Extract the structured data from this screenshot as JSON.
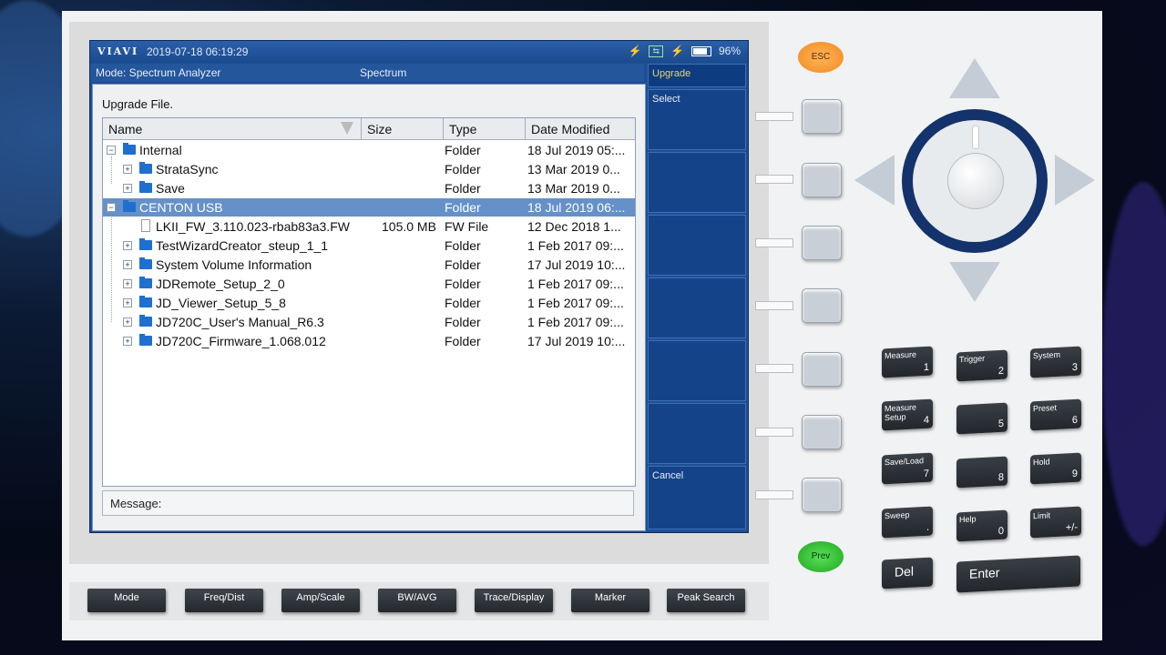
{
  "status": {
    "brand": "VIAVI",
    "datetime": "2019-07-18  06:19:29",
    "battery": "96%"
  },
  "mode": {
    "label": "Mode: Spectrum Analyzer",
    "view": "Spectrum"
  },
  "softkeys": [
    "Upgrade",
    "Select",
    "",
    "",
    "",
    "",
    "",
    "Cancel"
  ],
  "panel": {
    "title": "Upgrade File.",
    "columns": [
      "Name",
      "Size",
      "Type",
      "Date Modified"
    ],
    "rows": [
      {
        "name": "Internal",
        "size": "",
        "type": "Folder",
        "date": "18 Jul 2019 05:..."
      },
      {
        "name": "StrataSync",
        "size": "",
        "type": "Folder",
        "date": "13 Mar 2019 0..."
      },
      {
        "name": "Save",
        "size": "",
        "type": "Folder",
        "date": "13 Mar 2019 0..."
      },
      {
        "name": "CENTON USB",
        "size": "",
        "type": "Folder",
        "date": "18 Jul 2019 06:..."
      },
      {
        "name": "LKII_FW_3.110.023-rbab83a3.FW",
        "size": "105.0 MB",
        "type": "FW File",
        "date": "12 Dec 2018 1..."
      },
      {
        "name": "TestWizardCreator_steup_1_1",
        "size": "",
        "type": "Folder",
        "date": "1 Feb 2017 09:..."
      },
      {
        "name": "System Volume Information",
        "size": "",
        "type": "Folder",
        "date": "17 Jul 2019 10:..."
      },
      {
        "name": "JDRemote_Setup_2_0",
        "size": "",
        "type": "Folder",
        "date": "1 Feb 2017 09:..."
      },
      {
        "name": "JD_Viewer_Setup_5_8",
        "size": "",
        "type": "Folder",
        "date": "1 Feb 2017 09:..."
      },
      {
        "name": "JD720C_User's Manual_R6.3",
        "size": "",
        "type": "Folder",
        "date": "1 Feb 2017 09:..."
      },
      {
        "name": "JD720C_Firmware_1.068.012",
        "size": "",
        "type": "Folder",
        "date": "17 Jul 2019 10:..."
      }
    ],
    "message_label": "Message:"
  },
  "hardware": {
    "esc": "ESC",
    "prev": "Prev",
    "keypad": [
      {
        "label": "Measure",
        "num": "1"
      },
      {
        "label": "Trigger",
        "num": "2"
      },
      {
        "label": "System",
        "num": "3"
      },
      {
        "label": "Measure\nSetup",
        "num": "4"
      },
      {
        "label": "",
        "num": "5"
      },
      {
        "label": "Preset",
        "num": "6"
      },
      {
        "label": "Save/Load",
        "num": "7"
      },
      {
        "label": "",
        "num": "8"
      },
      {
        "label": "Hold",
        "num": "9"
      },
      {
        "label": "Sweep",
        "num": "."
      },
      {
        "label": "Help",
        "num": "0"
      },
      {
        "label": "Limit",
        "num": "+/-"
      }
    ],
    "del": "Del",
    "enter": "Enter",
    "bottom_keys": [
      "Mode",
      "Freq/Dist",
      "Amp/Scale",
      "BW/AVG",
      "Trace/Display",
      "Marker",
      "Peak Search"
    ]
  }
}
